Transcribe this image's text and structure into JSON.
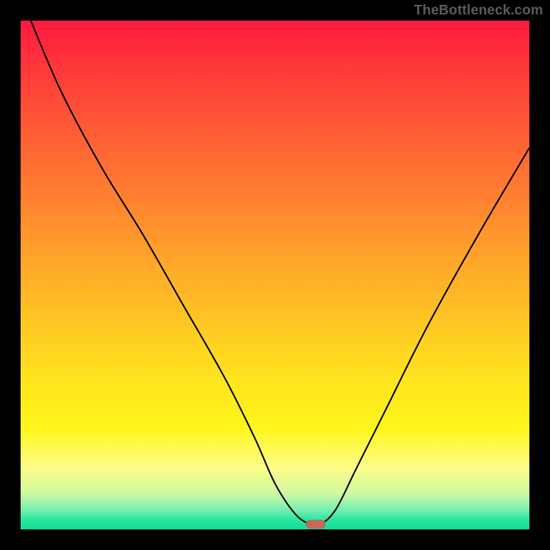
{
  "watermark": "TheBottleneck.com",
  "chart_data": {
    "type": "line",
    "title": "",
    "xlabel": "",
    "ylabel": "",
    "xlim": [
      0,
      100
    ],
    "ylim": [
      0,
      100
    ],
    "grid": false,
    "legend": false,
    "series": [
      {
        "name": "bottleneck-curve",
        "x": [
          2,
          8,
          16,
          24,
          32,
          40,
          46,
          50,
          54,
          57,
          59,
          62,
          66,
          72,
          80,
          90,
          100
        ],
        "y": [
          100,
          86,
          71,
          58,
          44,
          30,
          18,
          9,
          3,
          1,
          1,
          4,
          12,
          24,
          40,
          58,
          75
        ]
      }
    ],
    "marker": {
      "x": 58,
      "y": 1,
      "color": "#c46a5a"
    },
    "background_gradient": {
      "stops": [
        {
          "pos": 0,
          "color": "#ff1a3f"
        },
        {
          "pos": 50,
          "color": "#ffc324"
        },
        {
          "pos": 88,
          "color": "#fdfd8a"
        },
        {
          "pos": 100,
          "color": "#12df95"
        }
      ]
    }
  }
}
